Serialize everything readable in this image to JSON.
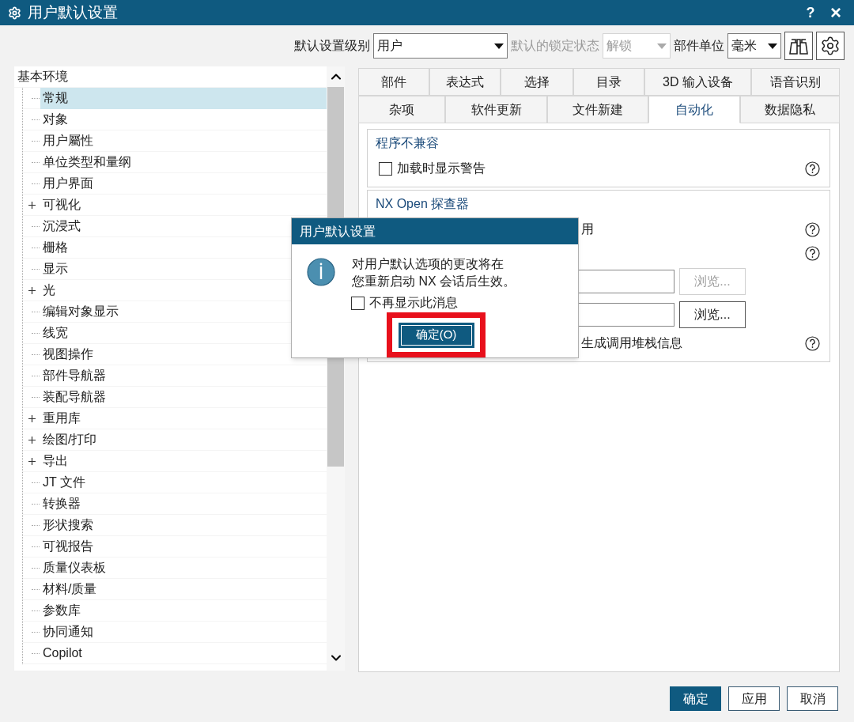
{
  "window": {
    "title": "用户默认设置",
    "help": "?",
    "close": "×"
  },
  "toolbar": {
    "settings_level": {
      "label": "默认设置级别",
      "value": "用户",
      "disabled": false
    },
    "lock_state": {
      "label": "默认的锁定状态",
      "value": "解锁",
      "disabled": true
    },
    "part_units": {
      "label": "部件单位",
      "value": "毫米",
      "disabled": false
    }
  },
  "tree": [
    {
      "label": "基本环境",
      "selected": false,
      "children": [
        {
          "label": "常规",
          "selected": true
        },
        {
          "label": "对象",
          "selected": false
        },
        {
          "label": "用户屬性",
          "selected": false
        },
        {
          "label": "单位类型和量纲",
          "selected": false
        },
        {
          "label": "用户界面",
          "selected": false
        },
        {
          "label": "可视化",
          "selected": false,
          "expanded": false
        },
        {
          "label": "沉浸式",
          "selected": false
        },
        {
          "label": "栅格",
          "selected": false
        },
        {
          "label": "显示",
          "selected": false
        },
        {
          "label": "光",
          "selected": false,
          "expanded": false
        },
        {
          "label": "编辑对象显示",
          "selected": false
        },
        {
          "label": "线宽",
          "selected": false
        },
        {
          "label": "视图操作",
          "selected": false
        },
        {
          "label": "部件导航器",
          "selected": false
        },
        {
          "label": "装配导航器",
          "selected": false
        },
        {
          "label": "重用库",
          "selected": false,
          "expanded": false
        },
        {
          "label": "绘图/打印",
          "selected": false,
          "expanded": false
        },
        {
          "label": "导出",
          "selected": false,
          "expanded": false
        },
        {
          "label": "JT 文件",
          "selected": false
        },
        {
          "label": "转换器",
          "selected": false
        },
        {
          "label": "形状搜索",
          "selected": false
        },
        {
          "label": "可视报告",
          "selected": false
        },
        {
          "label": "质量仪表板",
          "selected": false
        },
        {
          "label": "材料/质量",
          "selected": false
        },
        {
          "label": "参数库",
          "selected": false
        },
        {
          "label": "协同通知",
          "selected": false
        },
        {
          "label": "Copilot",
          "selected": false
        }
      ]
    }
  ],
  "tab_rows": [
    [
      {
        "label": "部件",
        "selected": false
      },
      {
        "label": "表达式",
        "selected": false
      },
      {
        "label": "选择",
        "selected": false
      },
      {
        "label": "目录",
        "selected": false
      },
      {
        "label": "3D 输入设备",
        "selected": false
      },
      {
        "label": "语音识别",
        "selected": false
      }
    ],
    [
      {
        "label": "杂项",
        "selected": false
      },
      {
        "label": "软件更新",
        "selected": false
      },
      {
        "label": "文件新建",
        "selected": false
      },
      {
        "label": "自动化",
        "selected": true
      },
      {
        "label": "数据隐私",
        "selected": false
      }
    ]
  ],
  "groups": [
    {
      "title": "程序不兼容",
      "items": [
        {
          "kind": "checkbox",
          "label": "加载时显示警告",
          "checked": false,
          "help": true
        }
      ]
    },
    {
      "title": "NX Open 探查器",
      "items": [
        {
          "kind": "label",
          "label": "用",
          "help": true
        },
        {
          "kind": "label",
          "help": true
        },
        {
          "kind": "file",
          "browse": {
            "label": "浏览...",
            "disabled": true
          }
        },
        {
          "kind": "file",
          "browse": {
            "label": "浏览...",
            "disabled": false
          }
        },
        {
          "kind": "label",
          "label": "生成调用堆栈信息",
          "help": true
        }
      ]
    }
  ],
  "dialog": {
    "title": "用户默认设置",
    "message_lines": [
      "对用户默认选项的更改将在",
      "您重新启动 NX 会话后生效。"
    ],
    "checkbox": {
      "label": "不再显示此消息",
      "checked": false
    },
    "ok_button": {
      "label": "确定(O)",
      "highlighted": true
    }
  },
  "buttons": [
    {
      "label": "确定",
      "primary": true
    },
    {
      "label": "应用",
      "primary": false
    },
    {
      "label": "取消",
      "primary": false
    }
  ]
}
